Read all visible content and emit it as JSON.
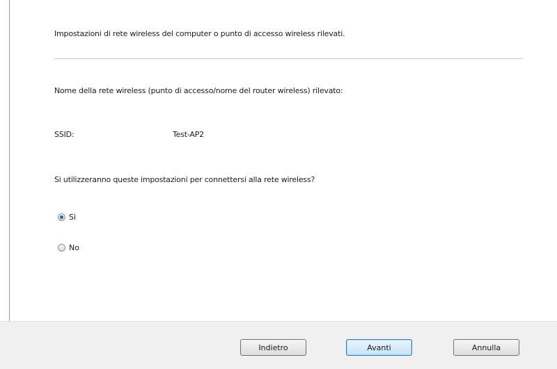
{
  "content": {
    "intro_text": "Impostazioni di rete wireless del computer o punto di accesso wireless rilevati.",
    "network_label": "Nome della rete wireless (punto di accesso/nome del router wireless) rilevato:",
    "ssid_label": "SSID:",
    "ssid_value": "Test-AP2",
    "question": "Si utilizzeranno queste impostazioni per connettersi alla rete wireless?",
    "options": [
      {
        "label": "Sì",
        "checked": true
      },
      {
        "label": "No",
        "checked": false
      }
    ]
  },
  "footer": {
    "back_label": "Indietro",
    "next_label": "Avanti",
    "cancel_label": "Annulla"
  },
  "colors": {
    "accent": "#3c7fb1",
    "radio_dot": "#2a5fb5",
    "footer_bg": "#f0f0f0"
  }
}
